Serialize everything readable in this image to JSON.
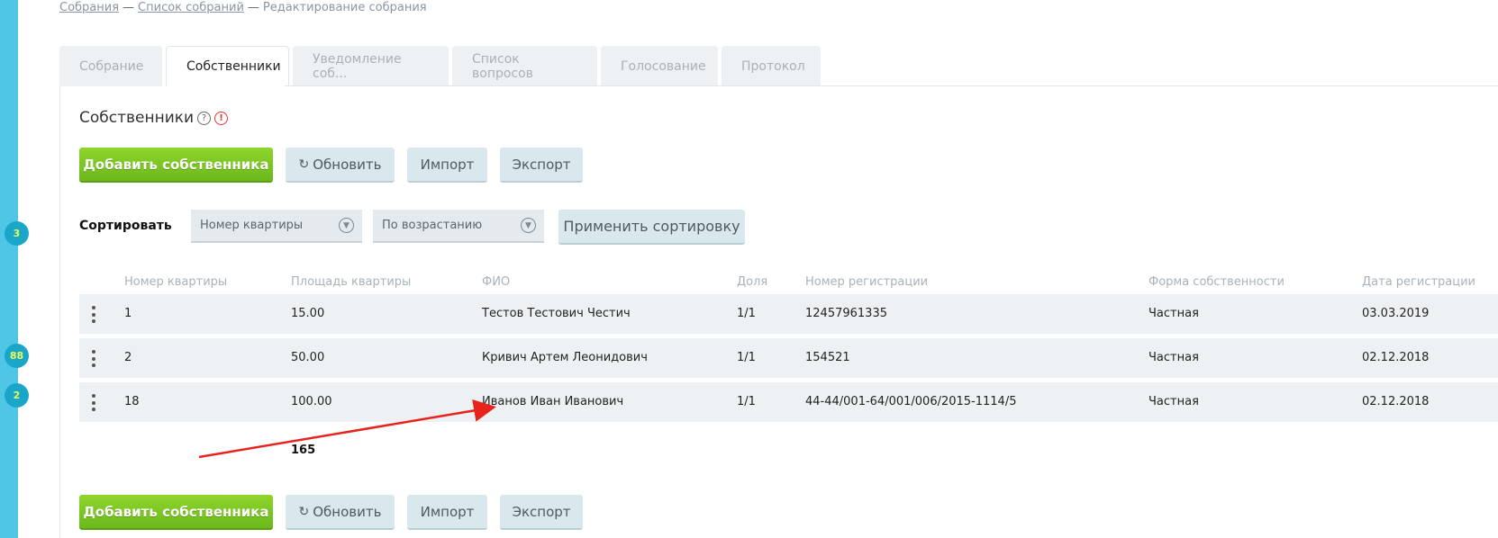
{
  "sidebar": {
    "badges": [
      "3",
      "88",
      "2"
    ]
  },
  "breadcrumb": {
    "item1": "Собрания",
    "sep1": "—",
    "item2": "Список собраний",
    "sep2": "—",
    "current": "Редактирование собрания"
  },
  "tabs": [
    {
      "label": "Собрание",
      "active": false
    },
    {
      "label": "Собственники",
      "active": true
    },
    {
      "label": "Уведомление соб...",
      "active": false
    },
    {
      "label": "Список вопросов",
      "active": false
    },
    {
      "label": "Голосование",
      "active": false
    },
    {
      "label": "Протокол",
      "active": false
    }
  ],
  "section": {
    "title": "Собственники",
    "help_icon": "?",
    "alert_icon": "!"
  },
  "toolbar": {
    "add_label": "Добавить собственника",
    "refresh_icon": "↻",
    "refresh_label": "Обновить",
    "import_label": "Импорт",
    "export_label": "Экспорт"
  },
  "sort": {
    "label": "Сортировать",
    "field_value": "Номер квартиры",
    "order_value": "По возрастанию",
    "apply_label": "Применить сортировку",
    "chevron_icon": "chevron-down-circle-icon"
  },
  "table": {
    "headers": [
      "Номер квартиры",
      "Площадь квартиры",
      "ФИО",
      "Доля",
      "Номер регистрации",
      "Форма собственности",
      "Дата регистрации"
    ],
    "rows": [
      {
        "apartment": "1",
        "area": "15.00",
        "name": "Тестов Тестович Честич",
        "share": "1/1",
        "reg_number": "12457961335",
        "ownership": "Частная",
        "reg_date": "03.03.2019"
      },
      {
        "apartment": "2",
        "area": "50.00",
        "name": "Кривич Артем Леонидович",
        "share": "1/1",
        "reg_number": "154521",
        "ownership": "Частная",
        "reg_date": "02.12.2018"
      },
      {
        "apartment": "18",
        "area": "100.00",
        "name": "Иванов Иван Иванович",
        "share": "1/1",
        "reg_number": "44-44/001-64/001/006/2015-1114/5",
        "ownership": "Частная",
        "reg_date": "02.12.2018"
      }
    ],
    "total_area": "165"
  },
  "colors": {
    "accent_green": "#7cc425",
    "side_strip": "#4fc6e6",
    "annotation_arrow": "#e8231c"
  }
}
